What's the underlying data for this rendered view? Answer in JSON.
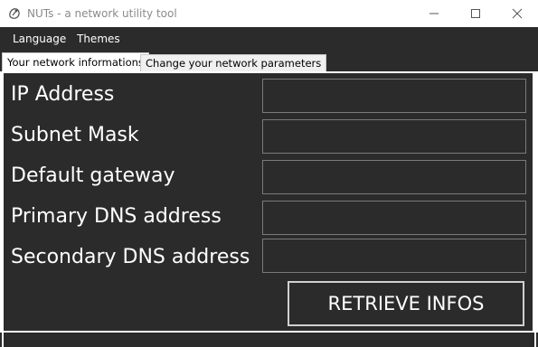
{
  "window": {
    "title": "NUTs - a network utility tool",
    "controls": [
      "minimize-icon",
      "maximize-icon",
      "close-icon"
    ]
  },
  "menubar": {
    "items": [
      {
        "label": "Language"
      },
      {
        "label": "Themes"
      }
    ]
  },
  "tabs": [
    {
      "label": "Your network informations",
      "selected": true
    },
    {
      "label": "Change your network parameters",
      "selected": false
    }
  ],
  "form": {
    "rows": [
      {
        "label": "IP Address",
        "value": ""
      },
      {
        "label": "Subnet Mask",
        "value": ""
      },
      {
        "label": "Default gateway",
        "value": ""
      },
      {
        "label": "Primary DNS address",
        "value": ""
      },
      {
        "label": "Secondary DNS address",
        "value": ""
      }
    ],
    "retrieve_label": "RETRIEVE INFOS"
  },
  "colors": {
    "background": "#2b2b2b",
    "text": "#ffffff",
    "field_border": "#7a7a7a",
    "titlebar": "#ffffff"
  }
}
